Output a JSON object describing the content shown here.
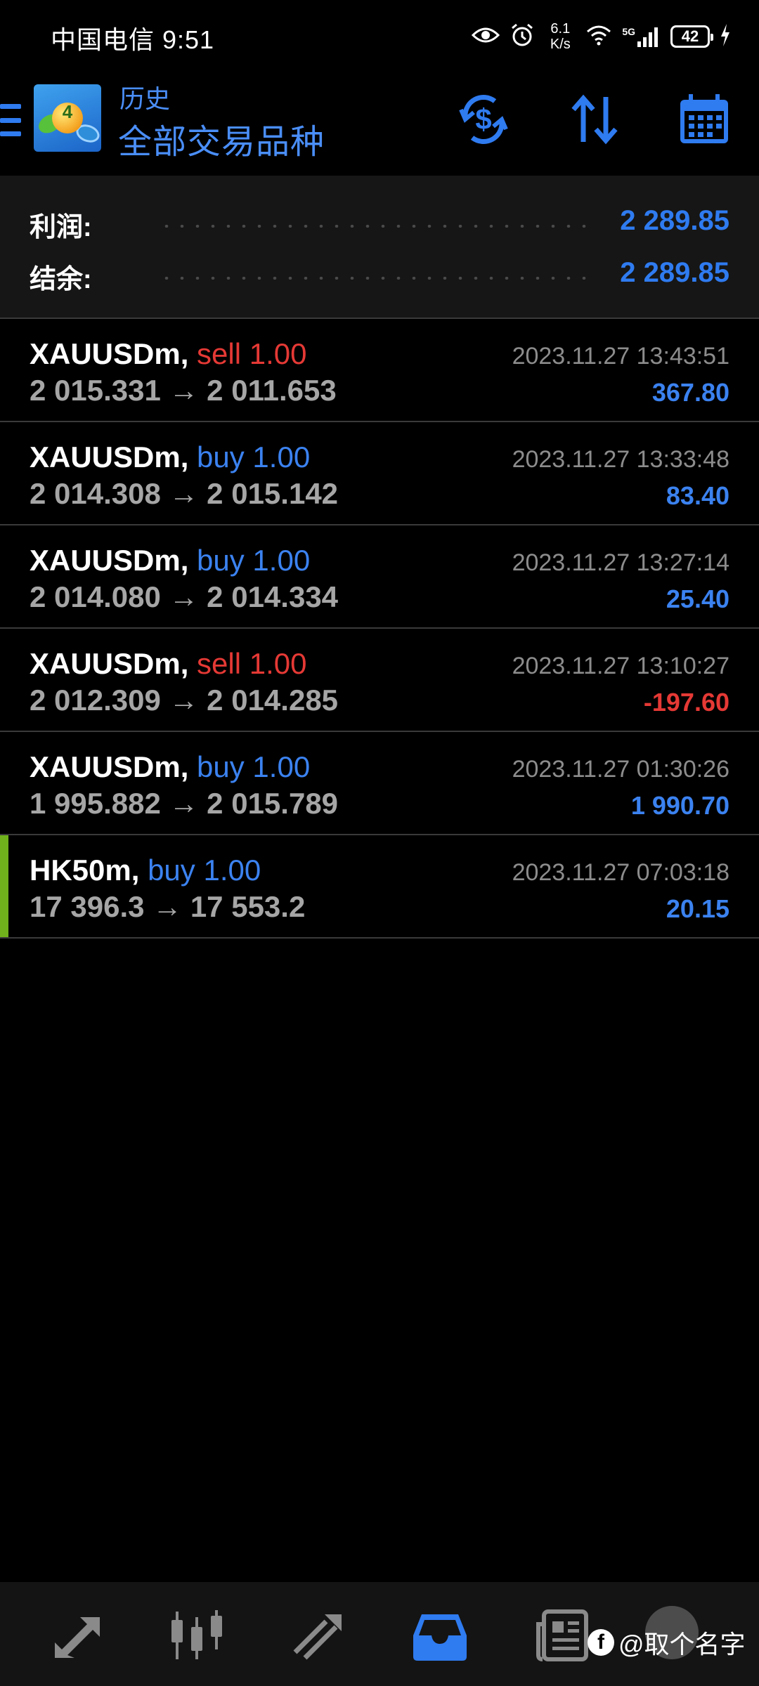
{
  "status_bar": {
    "carrier_time": "中国电信 9:51",
    "net_speed_value": "6.1",
    "net_speed_unit": "K/s",
    "signal_label": "5G",
    "battery": "42"
  },
  "toolbar": {
    "subtitle": "历史",
    "title": "全部交易品种",
    "icons": [
      "menu-icon",
      "app-logo",
      "currency-exchange-icon",
      "sort-icon",
      "calendar-icon"
    ]
  },
  "summary": {
    "profit_label": "利润:",
    "profit_value": "2 289.85",
    "balance_label": "结余:",
    "balance_value": "2 289.85"
  },
  "trades": [
    {
      "symbol": "XAUUSDm,",
      "type": "sell 1.00",
      "side": "sell",
      "prices": "2 015.331 → 2 011.653",
      "time": "2023.11.27 13:43:51",
      "profit": "367.80",
      "profit_sign": "pos"
    },
    {
      "symbol": "XAUUSDm,",
      "type": "buy 1.00",
      "side": "buy",
      "prices": "2 014.308 → 2 015.142",
      "time": "2023.11.27 13:33:48",
      "profit": "83.40",
      "profit_sign": "pos"
    },
    {
      "symbol": "XAUUSDm,",
      "type": "buy 1.00",
      "side": "buy",
      "prices": "2 014.080 → 2 014.334",
      "time": "2023.11.27 13:27:14",
      "profit": "25.40",
      "profit_sign": "pos"
    },
    {
      "symbol": "XAUUSDm,",
      "type": "sell 1.00",
      "side": "sell",
      "prices": "2 012.309 → 2 014.285",
      "time": "2023.11.27 13:10:27",
      "profit": "-197.60",
      "profit_sign": "neg"
    },
    {
      "symbol": "XAUUSDm,",
      "type": "buy 1.00",
      "side": "buy",
      "prices": "1 995.882 → 2 015.789",
      "time": "2023.11.27 01:30:26",
      "profit": "1 990.70",
      "profit_sign": "pos"
    },
    {
      "symbol": "HK50m,",
      "type": "buy 1.00",
      "side": "buy",
      "prices": "17 396.3 → 17 553.2",
      "time": "2023.11.27 07:03:18",
      "profit": "20.15",
      "profit_sign": "pos",
      "highlight": true
    }
  ],
  "bottom_nav": {
    "items": [
      "quotes-icon",
      "chart-candles-icon",
      "trade-icon",
      "history-inbox-icon",
      "news-icon"
    ],
    "active": "history-inbox-icon"
  },
  "watermark": {
    "logo_letter": "f",
    "text": "@取个名字"
  },
  "colors": {
    "accent_blue": "#2f7bf0",
    "sell_red": "#e53935",
    "highlight_green": "#6fb21b"
  }
}
